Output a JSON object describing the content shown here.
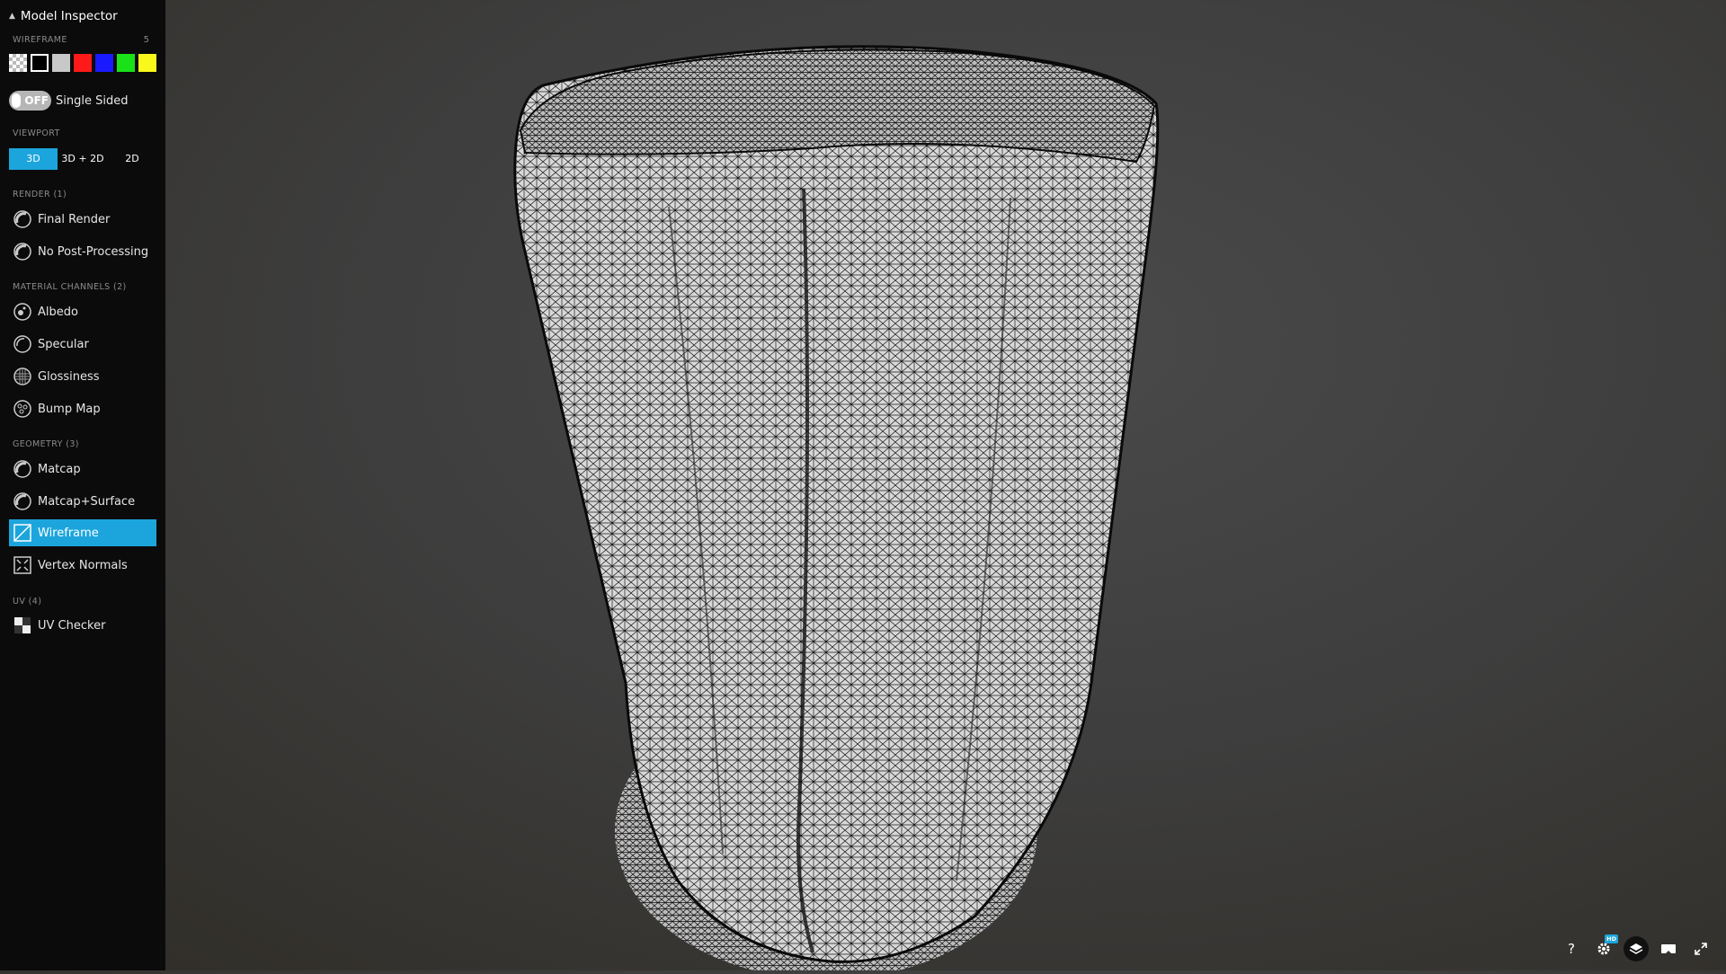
{
  "sidebar": {
    "title": "Model Inspector",
    "wireframe": {
      "label": "WIREFRAME",
      "count": "5",
      "swatches": [
        {
          "name": "transparent",
          "color": "checker"
        },
        {
          "name": "black",
          "color": "#000000"
        },
        {
          "name": "grey",
          "color": "#c8c8c8"
        },
        {
          "name": "red",
          "color": "#ff1a1a"
        },
        {
          "name": "blue",
          "color": "#1a1aff"
        },
        {
          "name": "green",
          "color": "#19e219"
        },
        {
          "name": "yellow",
          "color": "#f8f81a"
        }
      ]
    },
    "single_sided": {
      "state": "OFF",
      "label": "Single Sided"
    },
    "viewport": {
      "label": "VIEWPORT",
      "options": [
        "3D",
        "3D + 2D",
        "2D"
      ],
      "selected": "3D"
    },
    "render": {
      "label": "RENDER (1)",
      "items": [
        {
          "label": "Final Render",
          "icon": "final-render-icon"
        },
        {
          "label": "No Post-Processing",
          "icon": "no-post-processing-icon"
        }
      ]
    },
    "material_channels": {
      "label": "MATERIAL CHANNELS (2)",
      "items": [
        {
          "label": "Albedo",
          "icon": "albedo-icon"
        },
        {
          "label": "Specular",
          "icon": "specular-icon"
        },
        {
          "label": "Glossiness",
          "icon": "glossiness-icon"
        },
        {
          "label": "Bump Map",
          "icon": "bump-map-icon"
        }
      ]
    },
    "geometry": {
      "label": "GEOMETRY (3)",
      "items": [
        {
          "label": "Matcap",
          "icon": "matcap-icon"
        },
        {
          "label": "Matcap+Surface",
          "icon": "matcap-surface-icon"
        },
        {
          "label": "Wireframe",
          "icon": "wireframe-icon",
          "active": true
        },
        {
          "label": "Vertex Normals",
          "icon": "vertex-normals-icon"
        }
      ]
    },
    "uv": {
      "label": "UV (4)",
      "items": [
        {
          "label": "UV Checker",
          "icon": "uv-checker-icon"
        }
      ]
    }
  },
  "toolbar": {
    "help": "?",
    "hd_badge": "HD",
    "icons": [
      "help-icon",
      "settings-icon",
      "layers-icon",
      "vr-icon",
      "fullscreen-icon"
    ]
  },
  "colors": {
    "accent": "#1ca5dc",
    "sidebar_bg": "#0b0b0b"
  }
}
